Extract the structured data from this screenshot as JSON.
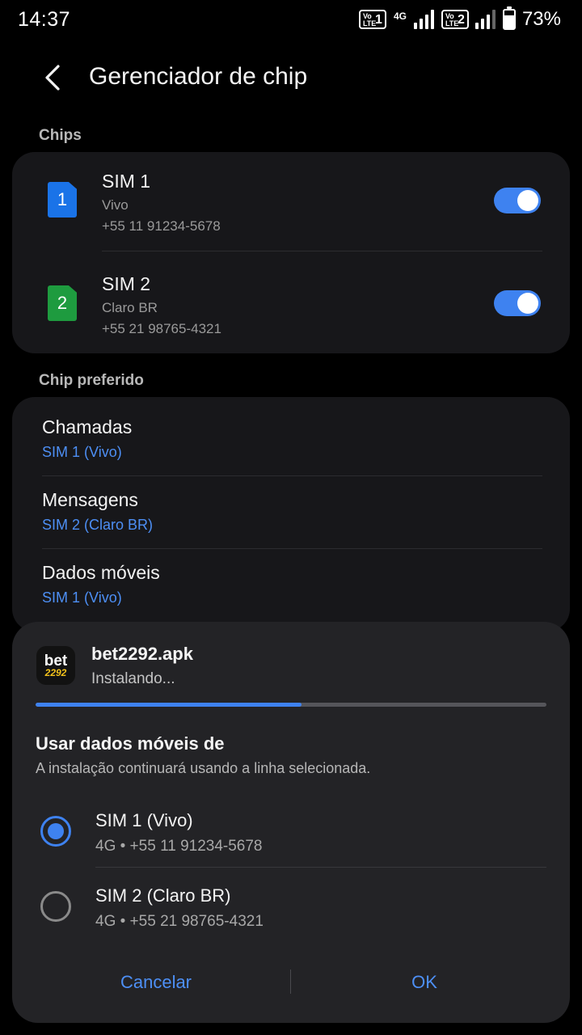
{
  "status_bar": {
    "time": "14:37",
    "volte_label": "Vo LTE",
    "sim1_indicator": "1",
    "sim2_indicator": "2",
    "network_type": "4G",
    "battery_percent": "73%",
    "battery_level": 0.73
  },
  "header": {
    "back_icon": "chevron-left-icon",
    "title": "Gerenciador de chip"
  },
  "chips": {
    "section_label": "Chips",
    "items": [
      {
        "badge": "1",
        "badge_color": "#1a73e8",
        "name": "SIM 1",
        "carrier": "Vivo",
        "number": "+55 11 91234-5678",
        "enabled": true
      },
      {
        "badge": "2",
        "badge_color": "#1e9b3f",
        "name": "SIM 2",
        "carrier": "Claro BR",
        "number": "+55 21 98765-4321",
        "enabled": true
      }
    ]
  },
  "preferred": {
    "section_label": "Chip preferido",
    "items": [
      {
        "label": "Chamadas",
        "value": "SIM 1 (Vivo)"
      },
      {
        "label": "Mensagens",
        "value": "SIM 2 (Claro BR)"
      },
      {
        "label": "Dados móveis",
        "value": "SIM 1 (Vivo)"
      }
    ]
  },
  "dialog": {
    "app_icon_text_top": "bet",
    "app_icon_text_bottom": "2292",
    "app_name": "bet2292.apk",
    "app_status": "Instalando...",
    "progress": 0.52,
    "title": "Usar dados móveis de",
    "subtitle": "A instalação continuará usando a linha selecionada.",
    "options": [
      {
        "label": "SIM 1 (Vivo)",
        "detail": "4G • +55 11 91234-5678",
        "selected": true
      },
      {
        "label": "SIM 2 (Claro BR)",
        "detail": "4G • +55 21 98765-4321",
        "selected": false
      }
    ],
    "cancel_label": "Cancelar",
    "ok_label": "OK"
  },
  "colors": {
    "accent": "#3e82f0",
    "background": "#000000",
    "card": "#17171a",
    "dialog": "#232326"
  }
}
